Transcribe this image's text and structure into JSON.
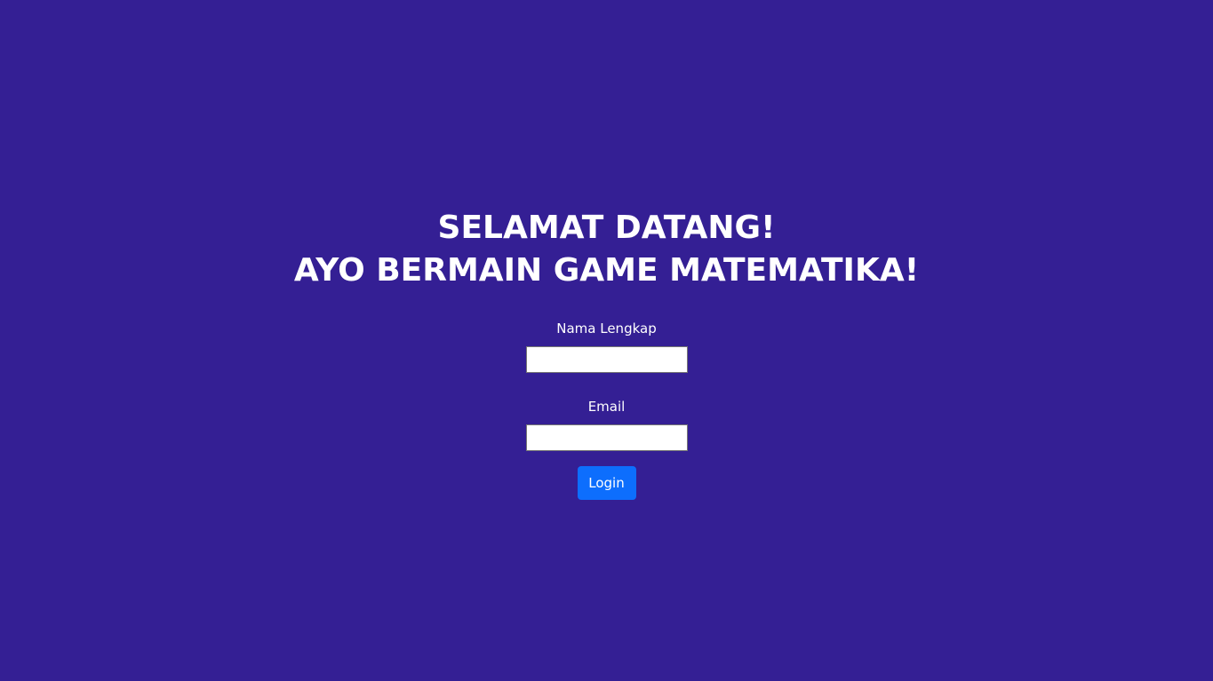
{
  "heading": {
    "line1": "SELAMAT DATANG!",
    "line2": "AYO BERMAIN GAME MATEMATIKA!"
  },
  "form": {
    "name_label": "Nama Lengkap",
    "name_value": "",
    "email_label": "Email",
    "email_value": "",
    "login_label": "Login"
  },
  "colors": {
    "background": "#341f94",
    "button": "#0d6efd",
    "text": "#ffffff"
  }
}
